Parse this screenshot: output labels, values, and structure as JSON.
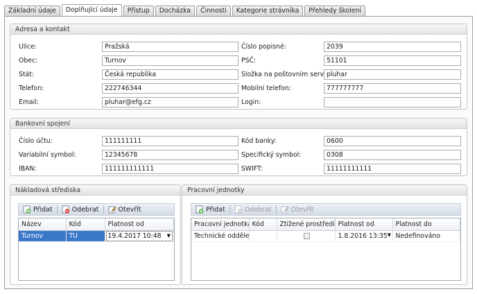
{
  "tabs": [
    "Základní údaje",
    "Doplňující údaje",
    "Přístup",
    "Docházka",
    "Činnosti",
    "Kategorie strávníka",
    "Přehledy školení"
  ],
  "active_tab_index": 1,
  "address": {
    "title": "Adresa a kontakt",
    "street_label": "Ulice:",
    "street_value": "Pražská",
    "city_label": "Obec:",
    "city_value": "Turnov",
    "country_label": "Stát:",
    "country_value": "Česká republika",
    "phone_label": "Telefon:",
    "phone_value": "222746344",
    "email_label": "Email:",
    "email_value": "pluhar@efg.cz",
    "house_number_label": "Číslo popisné:",
    "house_number_value": "2039",
    "zip_label": "PSČ:",
    "zip_value": "51101",
    "mail_folder_label": "Složka na poštovním serveru:",
    "mail_folder_value": "pluhar",
    "mobile_label": "Mobilní telefon:",
    "mobile_value": "777777777",
    "login_label": "Login:",
    "login_value": ""
  },
  "bank": {
    "title": "Bankovní spojení",
    "account_label": "Číslo účtu:",
    "account_value": "111111111",
    "varsym_label": "Variabilní symbol:",
    "varsym_value": "12345678",
    "iban_label": "IBAN:",
    "iban_value": "111111111111",
    "bankcode_label": "Kód banky:",
    "bankcode_value": "0600",
    "specsym_label": "Specifický symbol:",
    "specsym_value": "0308",
    "swift_label": "SWIFT:",
    "swift_value": "11111111111"
  },
  "cost_centers": {
    "title": "Nákladová střediska",
    "toolbar": {
      "add": "Přidat",
      "remove": "Odebrat",
      "open": "Otevřít"
    },
    "columns": [
      "Název",
      "Kód",
      "Platnost od"
    ],
    "rows": [
      {
        "name": "Turnov",
        "code": "TU",
        "valid_from": "19.4.2017 10:48"
      }
    ]
  },
  "work_units": {
    "title": "Pracovní jednotky",
    "toolbar": {
      "add": "Přidat",
      "remove": "Odebrat",
      "open": "Otevřít"
    },
    "columns": [
      "Pracovní jednotka",
      "Kód",
      "Ztížené prostředí",
      "Platnost od",
      "Platnost do"
    ],
    "rows": [
      {
        "unit": "Technické oddělení",
        "code": "",
        "hard_env": false,
        "valid_from": "1.8.2016 13:35",
        "valid_to": "Nedefinováno"
      }
    ]
  }
}
